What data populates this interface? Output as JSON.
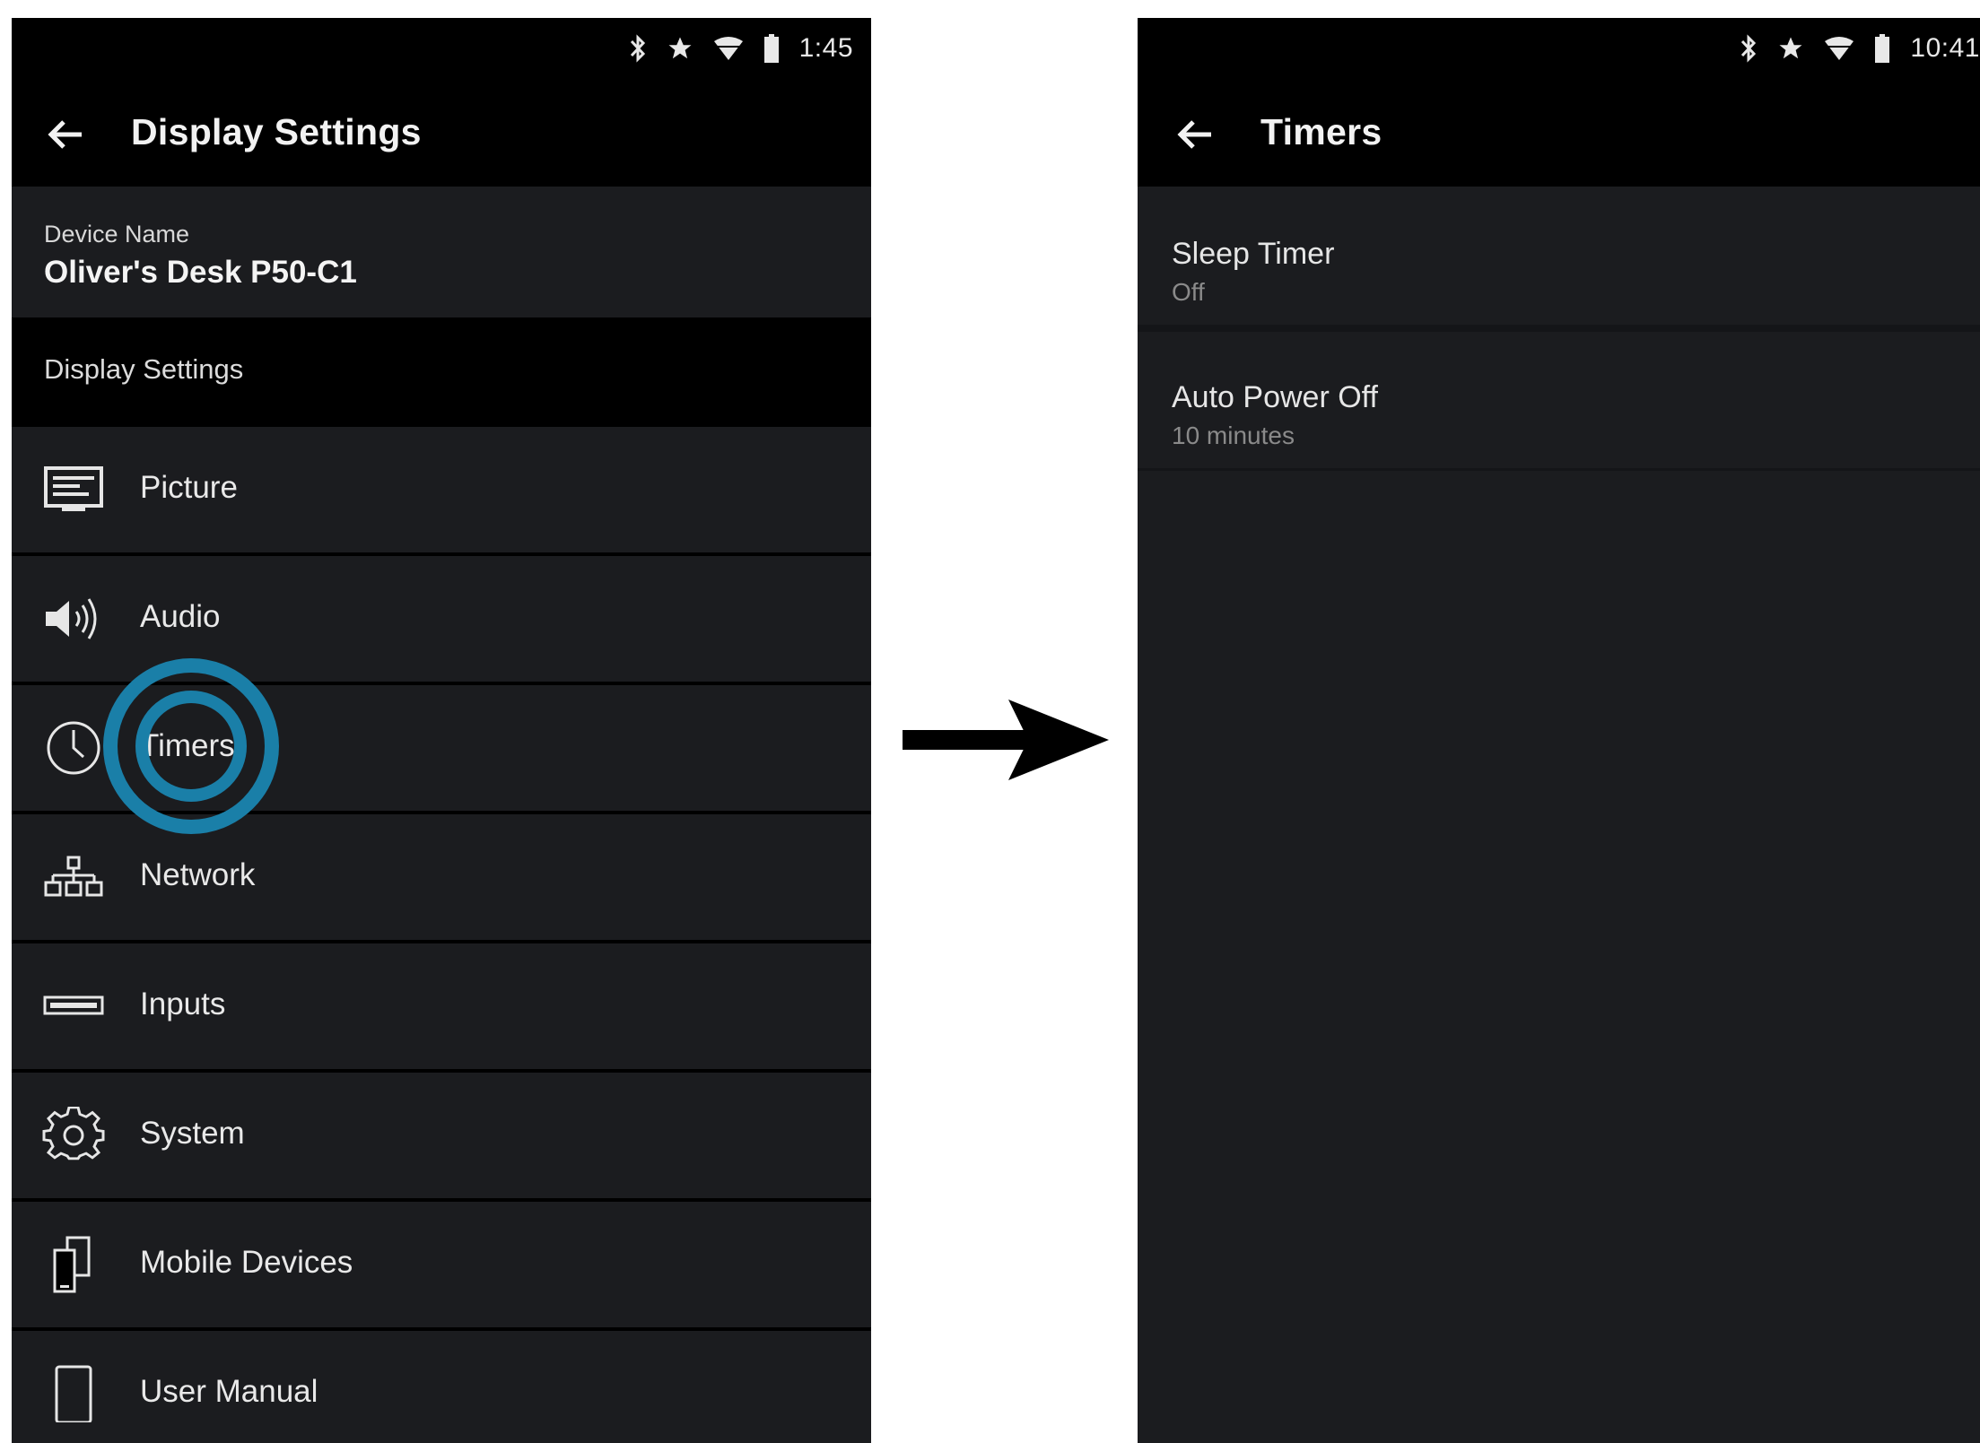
{
  "left_screen": {
    "status_time": "1:45",
    "title": "Display Settings",
    "device_name_caption": "Device Name",
    "device_name_value": "Oliver's Desk P50-C1",
    "section_header": "Display Settings",
    "menu": [
      {
        "label": "Picture",
        "icon": "picture-icon"
      },
      {
        "label": "Audio",
        "icon": "audio-icon"
      },
      {
        "label": "Timers",
        "icon": "timer-icon"
      },
      {
        "label": "Network",
        "icon": "network-icon"
      },
      {
        "label": "Inputs",
        "icon": "inputs-icon"
      },
      {
        "label": "System",
        "icon": "gear-icon"
      },
      {
        "label": "Mobile Devices",
        "icon": "mobile-devices-icon"
      },
      {
        "label": "User Manual",
        "icon": "manual-icon"
      }
    ]
  },
  "right_screen": {
    "status_time": "10:41",
    "title": "Timers",
    "items": [
      {
        "label": "Sleep Timer",
        "value": "Off"
      },
      {
        "label": "Auto Power Off",
        "value": "10 minutes"
      }
    ]
  },
  "colors": {
    "background": "#000000",
    "row": "#1b1c1f",
    "highlight_ring": "#1a7fa8"
  }
}
